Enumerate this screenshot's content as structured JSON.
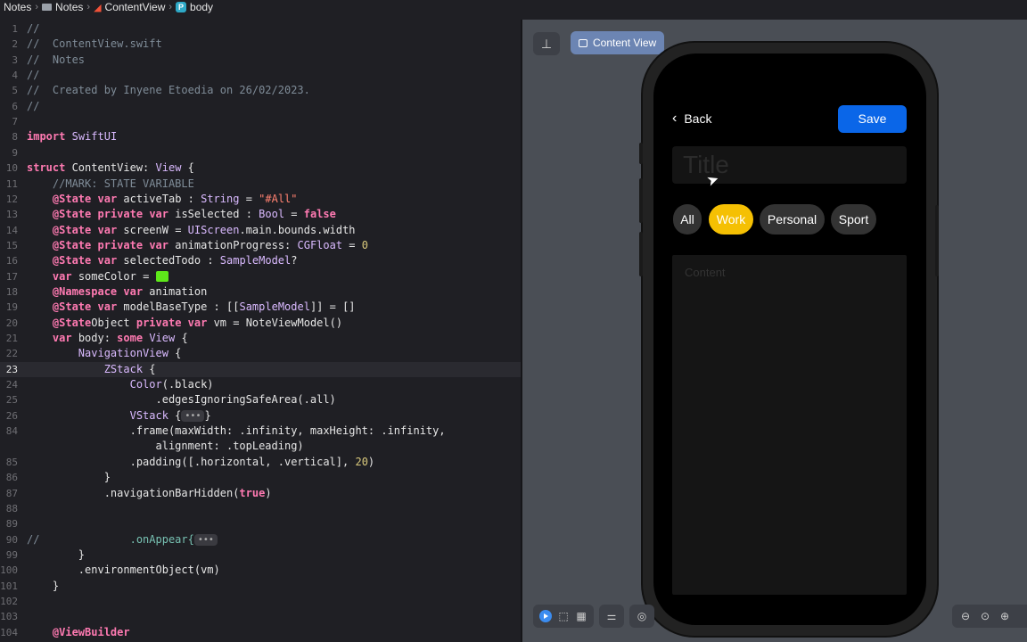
{
  "breadcrumb": {
    "project": "Notes",
    "folder": "Notes",
    "file": "ContentView",
    "symbol": "body",
    "symbol_badge": "P"
  },
  "editor": {
    "active_line_index": 22,
    "lines": [
      {
        "n": "1",
        "code": "//"
      },
      {
        "n": "2",
        "code": "//  ContentView.swift"
      },
      {
        "n": "3",
        "code": "//  Notes"
      },
      {
        "n": "4",
        "code": "//"
      },
      {
        "n": "5",
        "code": "//  Created by Inyene Etoedia on 26/02/2023."
      },
      {
        "n": "6",
        "code": "//"
      },
      {
        "n": "7",
        "code": ""
      },
      {
        "n": "8",
        "code": "import SwiftUI"
      },
      {
        "n": "9",
        "code": ""
      },
      {
        "n": "10",
        "code": "struct ContentView: View {"
      },
      {
        "n": "11",
        "code": "    //MARK: STATE VARIABLE"
      },
      {
        "n": "12",
        "code": "    @State var activeTab : String = \"#All\""
      },
      {
        "n": "13",
        "code": "    @State private var isSelected : Bool = false"
      },
      {
        "n": "14",
        "code": "    @State var screenW = UIScreen.main.bounds.width"
      },
      {
        "n": "15",
        "code": "    @State private var animationProgress: CGFloat = 0"
      },
      {
        "n": "16",
        "code": "    @State var selectedTodo : SampleModel?"
      },
      {
        "n": "17",
        "code": "    var someColor = "
      },
      {
        "n": "18",
        "code": "    @Namespace var animation"
      },
      {
        "n": "19",
        "code": "    @State var modelBaseType : [[SampleModel]] = []"
      },
      {
        "n": "20",
        "code": "    @StateObject private var vm = NoteViewModel()"
      },
      {
        "n": "21",
        "code": "    var body: some View {"
      },
      {
        "n": "22",
        "code": "        NavigationView {"
      },
      {
        "n": "23",
        "code": "            ZStack {"
      },
      {
        "n": "24",
        "code": "                Color(.black)"
      },
      {
        "n": "25",
        "code": "                    .edgesIgnoringSafeArea(.all)"
      },
      {
        "n": "26",
        "code": "                VStack {"
      },
      {
        "n": "84",
        "code": "                .frame(maxWidth: .infinity, maxHeight: .infinity,"
      },
      {
        "n": "",
        "code": "                    alignment: .topLeading)"
      },
      {
        "n": "85",
        "code": "                .padding([.horizontal, .vertical], 20)"
      },
      {
        "n": "86",
        "code": "            }"
      },
      {
        "n": "87",
        "code": "            .navigationBarHidden(true)"
      },
      {
        "n": "88",
        "code": ""
      },
      {
        "n": "89",
        "code": ""
      },
      {
        "n": "90",
        "code": "//              .onAppear{"
      },
      {
        "n": "99",
        "code": "        }"
      },
      {
        "n": "100",
        "code": "        .environmentObject(vm)"
      },
      {
        "n": "101",
        "code": "    }"
      },
      {
        "n": "102",
        "code": ""
      },
      {
        "n": "103",
        "code": ""
      },
      {
        "n": "104",
        "code": "    @ViewBuilder"
      }
    ],
    "fold_label": "•••"
  },
  "canvas": {
    "tab_label": "Content View",
    "pin_icon": "pin-icon"
  },
  "phone": {
    "back_label": "Back",
    "save_label": "Save",
    "title_placeholder": "Title",
    "content_placeholder": "Content",
    "chips": [
      "All",
      "Work",
      "Personal",
      "Sport"
    ],
    "selected_chip": "Work",
    "accent": "#f5c003",
    "save_color": "#0a66e8"
  }
}
